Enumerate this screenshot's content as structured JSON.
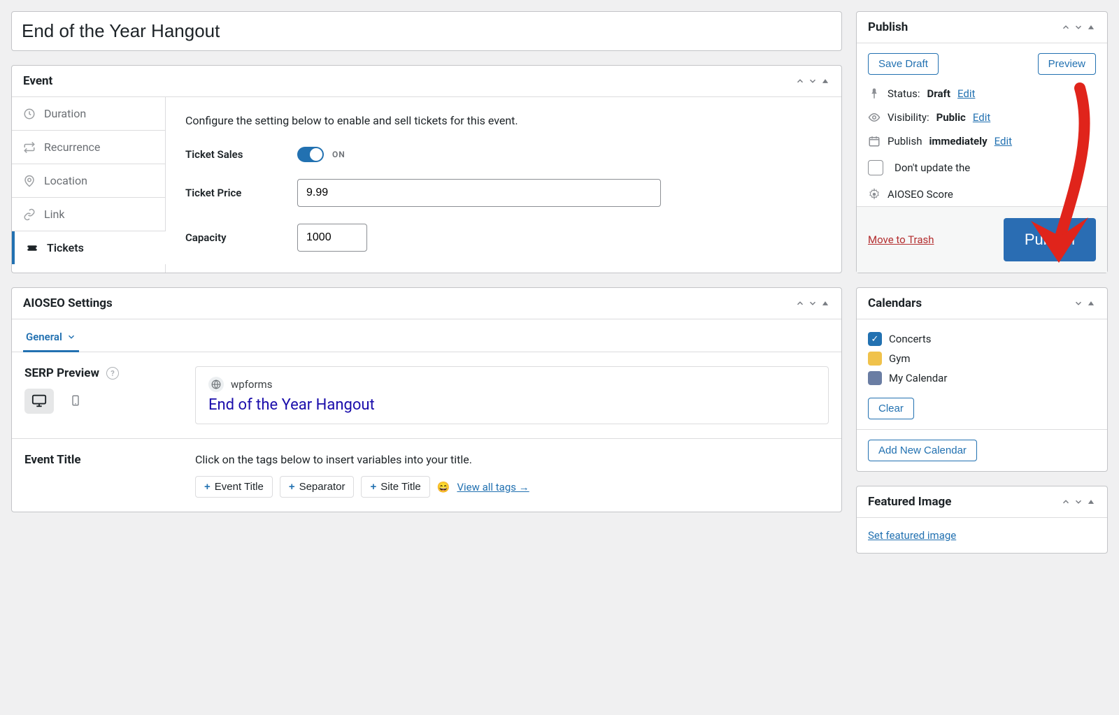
{
  "title_value": "End of the Year Hangout",
  "event_panel": {
    "title": "Event",
    "tabs": {
      "duration": "Duration",
      "recurrence": "Recurrence",
      "location": "Location",
      "link": "Link",
      "tickets": "Tickets"
    },
    "tickets": {
      "intro": "Configure the setting below to enable and sell tickets for this event.",
      "sales_label": "Ticket Sales",
      "sales_state": "ON",
      "price_label": "Ticket Price",
      "price_value": "9.99",
      "capacity_label": "Capacity",
      "capacity_value": "1000"
    }
  },
  "aioseo": {
    "panel_title": "AIOSEO Settings",
    "general_tab": "General",
    "serp_label": "SERP Preview",
    "serp_site": "wpforms",
    "serp_title": "End of the Year Hangout",
    "event_title_label": "Event Title",
    "event_title_desc": "Click on the tags below to insert variables into your title.",
    "tags": {
      "event_title": "Event Title",
      "separator": "Separator",
      "site_title": "Site Title"
    },
    "view_all": "View all tags →"
  },
  "publish": {
    "title": "Publish",
    "save_draft": "Save Draft",
    "preview": "Preview",
    "status_label": "Status:",
    "status_value": "Draft",
    "edit": "Edit",
    "visibility_label": "Visibility:",
    "visibility_value": "Public",
    "schedule_prefix": "Publish",
    "schedule_value": "immediately",
    "dont_update": "Don't update the",
    "aioseo_score": "AIOSEO Score",
    "trash": "Move to Trash",
    "publish_btn": "Publish"
  },
  "calendars": {
    "title": "Calendars",
    "items": {
      "concerts": "Concerts",
      "gym": "Gym",
      "my_calendar": "My Calendar"
    },
    "clear": "Clear",
    "add_new": "Add New Calendar"
  },
  "featured_image": {
    "title": "Featured Image",
    "set_link": "Set featured image"
  }
}
